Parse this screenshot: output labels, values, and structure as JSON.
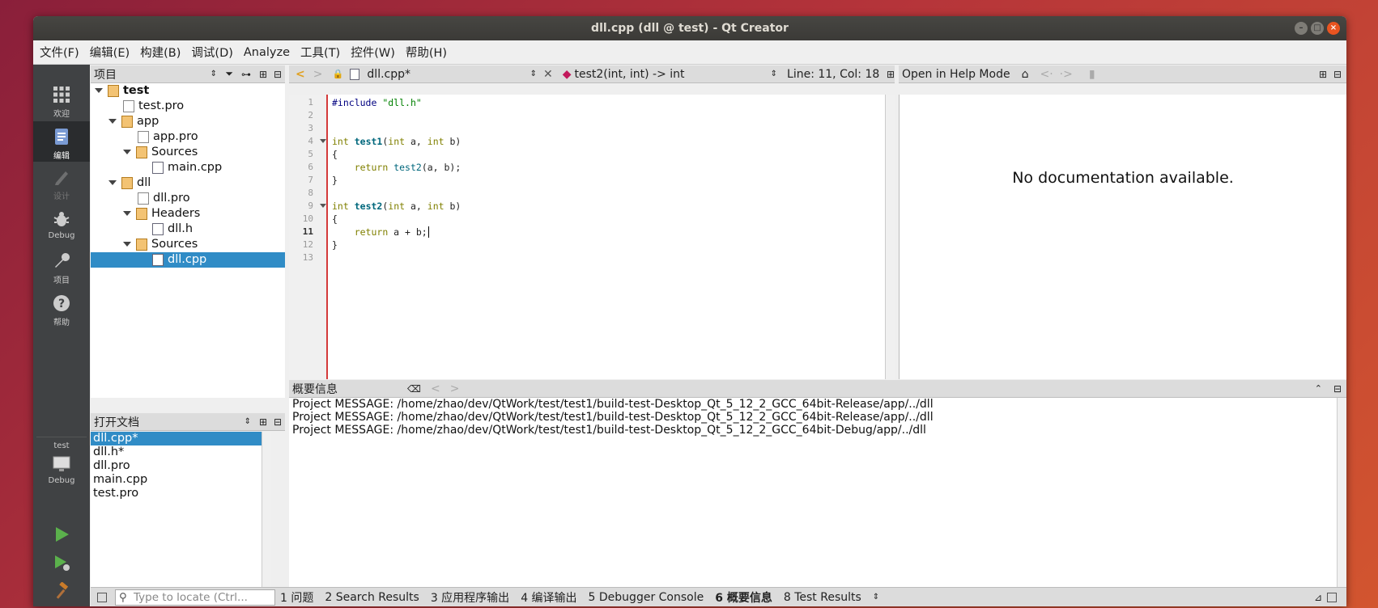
{
  "window": {
    "title": "dll.cpp (dll @ test) - Qt Creator"
  },
  "menu": [
    "文件(F)",
    "编辑(E)",
    "构建(B)",
    "调试(D)",
    "Analyze",
    "工具(T)",
    "控件(W)",
    "帮助(H)"
  ],
  "modes": {
    "welcome": "欢迎",
    "edit": "编辑",
    "design": "设计",
    "debug": "Debug",
    "projects": "项目",
    "help": "帮助"
  },
  "kit": {
    "project": "test",
    "config": "Debug"
  },
  "projects_panel": {
    "title": "项目",
    "tree": [
      {
        "label": "test",
        "bold": true
      },
      {
        "label": "test.pro"
      },
      {
        "label": "app"
      },
      {
        "label": "app.pro"
      },
      {
        "label": "Sources"
      },
      {
        "label": "main.cpp"
      },
      {
        "label": "dll"
      },
      {
        "label": "dll.pro"
      },
      {
        "label": "Headers"
      },
      {
        "label": "dll.h"
      },
      {
        "label": "Sources"
      },
      {
        "label": "dll.cpp",
        "selected": true
      }
    ]
  },
  "open_docs": {
    "title": "打开文档",
    "items": [
      "dll.cpp*",
      "dll.h*",
      "dll.pro",
      "main.cpp",
      "test.pro"
    ]
  },
  "editor": {
    "file": "dll.cpp*",
    "symbol": "test2(int, int) -> int",
    "position": "Line: 11, Col: 18",
    "line_numbers": [
      "1",
      "2",
      "3",
      "4",
      "5",
      "6",
      "7",
      "8",
      "9",
      "10",
      "11",
      "12",
      "13"
    ],
    "current_line": 11
  },
  "help": {
    "mode_label": "Open in Help Mode",
    "message": "No documentation available."
  },
  "output": {
    "title": "概要信息",
    "lines": [
      "Project MESSAGE: /home/zhao/dev/QtWork/test/test1/build-test-Desktop_Qt_5_12_2_GCC_64bit-Release/app/../dll",
      "Project MESSAGE: /home/zhao/dev/QtWork/test/test1/build-test-Desktop_Qt_5_12_2_GCC_64bit-Release/app/../dll",
      "Project MESSAGE: /home/zhao/dev/QtWork/test/test1/build-test-Desktop_Qt_5_12_2_GCC_64bit-Debug/app/../dll"
    ]
  },
  "statusbar": {
    "locate_placeholder": "Type to locate (Ctrl...",
    "tabs": [
      "1 问题",
      "2 Search Results",
      "3 应用程序输出",
      "4 编译输出",
      "5 Debugger Console",
      "6 概要信息",
      "8 Test Results"
    ]
  },
  "colors": {
    "accent": "#308cc6",
    "modebar": "#404244",
    "change_marker": "#d43a3a"
  }
}
